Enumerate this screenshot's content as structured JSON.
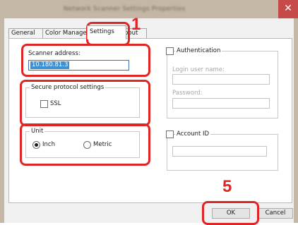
{
  "window": {
    "title": "Network Scanner Settings Properties",
    "close_glyph": "✕"
  },
  "tabs": [
    {
      "label": "General",
      "active": false
    },
    {
      "label": "Color Manageme",
      "active": false
    },
    {
      "label": "Settings",
      "active": true
    },
    {
      "label": "bout",
      "active": false
    }
  ],
  "scanner": {
    "label": "Scanner address:",
    "value": "10.180.81.3"
  },
  "secure": {
    "legend": "Secure protocol settings",
    "ssl_label": "SSL",
    "ssl_checked": false
  },
  "unit": {
    "legend": "Unit",
    "options": [
      {
        "label": "Inch",
        "selected": true
      },
      {
        "label": "Metric",
        "selected": false
      }
    ]
  },
  "auth": {
    "label": "Authentication",
    "checked": false,
    "login_label": "Login user name:",
    "login_value": "",
    "password_label": "Password:",
    "password_value": ""
  },
  "account": {
    "label": "Account ID",
    "checked": false,
    "value": ""
  },
  "buttons": {
    "ok": "OK",
    "cancel": "Cancel"
  },
  "callouts": {
    "tab_step": "1",
    "ok_step": "5",
    "color": "#e02525"
  }
}
